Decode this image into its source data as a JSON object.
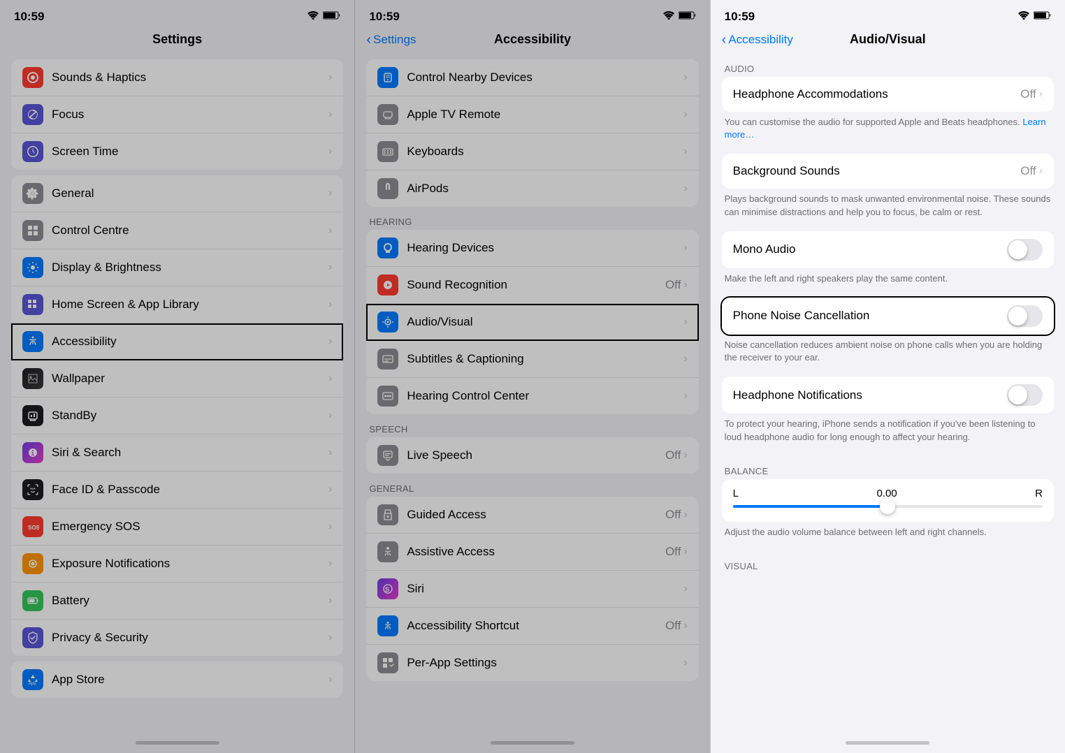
{
  "panels": {
    "panel1": {
      "statusBar": {
        "time": "10:59",
        "wifi": "📶",
        "battery": "🔋"
      },
      "navTitle": "Settings",
      "sections": [
        {
          "items": [
            {
              "icon": "🔊",
              "iconBg": "icon-red",
              "label": "Sounds & Haptics",
              "value": "",
              "hasChevron": true
            },
            {
              "icon": "🌙",
              "iconBg": "icon-purple",
              "label": "Focus",
              "value": "",
              "hasChevron": true
            },
            {
              "icon": "⏳",
              "iconBg": "icon-hourglass",
              "label": "Screen Time",
              "value": "",
              "hasChevron": true
            }
          ]
        },
        {
          "items": [
            {
              "icon": "⚙️",
              "iconBg": "icon-gray",
              "label": "General",
              "value": "",
              "hasChevron": true
            },
            {
              "icon": "☰",
              "iconBg": "icon-gray",
              "label": "Control Centre",
              "value": "",
              "hasChevron": true
            },
            {
              "icon": "☀️",
              "iconBg": "icon-blue",
              "label": "Display & Brightness",
              "value": "",
              "hasChevron": true
            },
            {
              "icon": "⊞",
              "iconBg": "icon-indigo",
              "label": "Home Screen & App Library",
              "value": "",
              "hasChevron": true
            },
            {
              "icon": "ⓘ",
              "iconBg": "icon-accessibility",
              "label": "Accessibility",
              "value": "",
              "hasChevron": true,
              "selected": true
            },
            {
              "icon": "🖼",
              "iconBg": "icon-wallpaper",
              "label": "Wallpaper",
              "value": "",
              "hasChevron": true
            },
            {
              "icon": "⏸",
              "iconBg": "icon-standby",
              "label": "StandBy",
              "value": "",
              "hasChevron": true
            },
            {
              "icon": "🎤",
              "iconBg": "icon-siri",
              "label": "Siri & Search",
              "value": "",
              "hasChevron": true
            },
            {
              "icon": "👤",
              "iconBg": "icon-faceid",
              "label": "Face ID & Passcode",
              "value": "",
              "hasChevron": true
            },
            {
              "icon": "🆘",
              "iconBg": "icon-sos",
              "label": "Emergency SOS",
              "value": "",
              "hasChevron": true
            },
            {
              "icon": "☢",
              "iconBg": "icon-exposure",
              "label": "Exposure Notifications",
              "value": "",
              "hasChevron": true
            },
            {
              "icon": "🔋",
              "iconBg": "icon-battery",
              "label": "Battery",
              "value": "",
              "hasChevron": true
            },
            {
              "icon": "🛡",
              "iconBg": "icon-privacy",
              "label": "Privacy & Security",
              "value": "",
              "hasChevron": true
            }
          ]
        },
        {
          "items": [
            {
              "icon": "A",
              "iconBg": "icon-appstore",
              "label": "App Store",
              "value": "",
              "hasChevron": true
            }
          ]
        }
      ]
    },
    "panel2": {
      "statusBar": {
        "time": "10:59"
      },
      "navBack": "Settings",
      "navTitle": "Accessibility",
      "sections": [
        {
          "label": "",
          "items": [
            {
              "icon": "📱",
              "iconBg": "icon-blue",
              "label": "Control Nearby Devices",
              "value": "",
              "hasChevron": true
            },
            {
              "icon": "📺",
              "iconBg": "icon-gray",
              "label": "Apple TV Remote",
              "value": "",
              "hasChevron": true
            },
            {
              "icon": "⌨",
              "iconBg": "icon-gray",
              "label": "Keyboards",
              "value": "",
              "hasChevron": true
            },
            {
              "icon": "🎧",
              "iconBg": "icon-gray",
              "label": "AirPods",
              "value": "",
              "hasChevron": true
            }
          ]
        },
        {
          "label": "HEARING",
          "items": [
            {
              "icon": "👂",
              "iconBg": "icon-blue",
              "label": "Hearing Devices",
              "value": "",
              "hasChevron": true
            },
            {
              "icon": "🔊",
              "iconBg": "icon-red",
              "label": "Sound Recognition",
              "value": "Off",
              "hasChevron": true
            },
            {
              "icon": "🔈",
              "iconBg": "icon-blue",
              "label": "Audio/Visual",
              "value": "",
              "hasChevron": true,
              "selected": true
            },
            {
              "icon": "💬",
              "iconBg": "icon-gray",
              "label": "Subtitles & Captioning",
              "value": "",
              "hasChevron": true
            },
            {
              "icon": "🎚",
              "iconBg": "icon-gray",
              "label": "Hearing Control Center",
              "value": "",
              "hasChevron": true
            }
          ]
        },
        {
          "label": "SPEECH",
          "items": [
            {
              "icon": "💬",
              "iconBg": "icon-gray",
              "label": "Live Speech",
              "value": "Off",
              "hasChevron": true
            }
          ]
        },
        {
          "label": "GENERAL",
          "items": [
            {
              "icon": "🔒",
              "iconBg": "icon-gray",
              "label": "Guided Access",
              "value": "Off",
              "hasChevron": true
            },
            {
              "icon": "🔑",
              "iconBg": "icon-gray",
              "label": "Assistive Access",
              "value": "Off",
              "hasChevron": true
            },
            {
              "icon": "🎤",
              "iconBg": "icon-siri",
              "label": "Siri",
              "value": "",
              "hasChevron": true
            },
            {
              "icon": "ⓘ",
              "iconBg": "icon-accessibility",
              "label": "Accessibility Shortcut",
              "value": "Off",
              "hasChevron": true
            },
            {
              "icon": "⚙️",
              "iconBg": "icon-gray",
              "label": "Per-App Settings",
              "value": "",
              "hasChevron": true
            }
          ]
        }
      ]
    },
    "panel3": {
      "statusBar": {
        "time": "10:59"
      },
      "navBack": "Accessibility",
      "navTitle": "Audio/Visual",
      "sections": {
        "audio": {
          "label": "AUDIO",
          "headphoneAccommodations": {
            "label": "Headphone Accommodations",
            "value": "Off",
            "description": "You can customise the audio for supported Apple and Beats headphones.",
            "learnMore": "Learn more…"
          },
          "backgroundSounds": {
            "label": "Background Sounds",
            "value": "Off",
            "description": "Plays background sounds to mask unwanted environmental noise. These sounds can minimise distractions and help you to focus, be calm or rest."
          },
          "monoAudio": {
            "label": "Mono Audio",
            "value": false,
            "description": "Make the left and right speakers play the same content."
          },
          "phoneNoiseCancellation": {
            "label": "Phone Noise Cancellation",
            "value": false,
            "selected": true,
            "description": "Noise cancellation reduces ambient noise on phone calls when you are holding the receiver to your ear."
          },
          "headphoneNotifications": {
            "label": "Headphone Notifications",
            "value": false,
            "description": "To protect your hearing, iPhone sends a notification if you've been listening to loud headphone audio for long enough to affect your hearing."
          }
        },
        "balance": {
          "label": "BALANCE",
          "l": "L",
          "r": "R",
          "value": "0.00",
          "sliderPosition": 50,
          "description": "Adjust the audio volume balance between left and right channels."
        },
        "visual": {
          "label": "VISUAL"
        }
      }
    }
  }
}
